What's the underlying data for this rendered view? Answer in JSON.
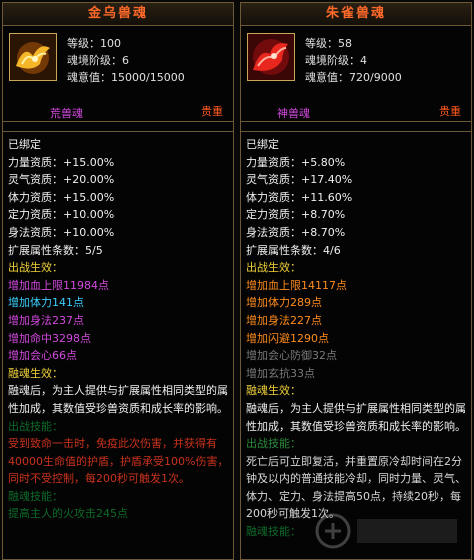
{
  "left": {
    "title": "金乌兽魂",
    "level": "等级：100",
    "stage": "魂境阶级：6",
    "will": "魂意值：15000/15000",
    "rank": "荒兽魂",
    "grade": "贵重",
    "bound": "已绑定",
    "apt": [
      "力量资质：+15.00%",
      "灵气资质：+20.00%",
      "体力资质：+15.00%",
      "定力资质：+10.00%",
      "身法资质：+10.00%"
    ],
    "ext_count": "扩展属性条数：5/5",
    "battle_effect": "出战生效：",
    "effects": [
      "增加血上限11984点",
      "增加体力141点",
      "增加身法237点",
      "增加命中3298点",
      "增加会心66点"
    ],
    "merge_title": "融魂生效：",
    "merge_desc": "融魂后，为主人提供与扩展属性相同类型的属性加成，其数值受珍兽资质和成长率的影响。",
    "skill_title": "出战技能：",
    "skill_desc": "受到致命一击时，免疫此次伤害，并获得有40000生命值的护盾，护盾承受100%伤害，同时不受控制，每200秒可触发1次。",
    "merge_skill_title": "融魂技能：",
    "merge_skill_desc": "提高主人的火攻击245点"
  },
  "right": {
    "title": "朱雀兽魂",
    "level": "等级：58",
    "stage": "魂境阶级：4",
    "will": "魂意值：720/9000",
    "rank": "神兽魂",
    "grade": "贵重",
    "bound": "已绑定",
    "apt": [
      "力量资质：+5.80%",
      "灵气资质：+17.40%",
      "体力资质：+11.60%",
      "定力资质：+8.70%",
      "身法资质：+8.70%"
    ],
    "ext_count": "扩展属性条数：4/6",
    "battle_effect": "出战生效：",
    "effects": [
      "增加血上限14117点",
      "增加体力289点",
      "增加身法227点",
      "增加闪避1290点"
    ],
    "inactive_effects": [
      "增加会心防御32点",
      "增加玄抗33点"
    ],
    "merge_title": "融魂生效：",
    "merge_desc": "融魂后，为主人提供与扩展属性相同类型的属性加成，其数值受珍兽资质和成长率的影响。",
    "skill_title": "出战技能：",
    "skill_desc": "死亡后可立即复活，并重置原冷却时间在2分钟及以内的普通技能冷却，同时力量、灵气、体力、定力、身法提高50点，持续20秒，每200秒可触发1次。",
    "merge_skill_title": "融魂技能："
  }
}
